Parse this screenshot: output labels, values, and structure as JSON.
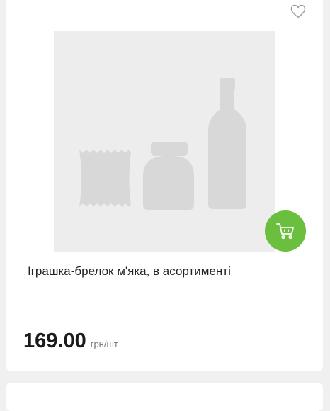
{
  "product": {
    "title": "Іграшка-брелок м'яка, в асортименті",
    "price": "169.00",
    "unit": "грн/шт",
    "image": "placeholder-product-image"
  },
  "icons": {
    "favorite": "heart-icon",
    "cart": "cart-icon"
  },
  "colors": {
    "accent": "#6bbf3e",
    "image_bg": "#ededed"
  }
}
